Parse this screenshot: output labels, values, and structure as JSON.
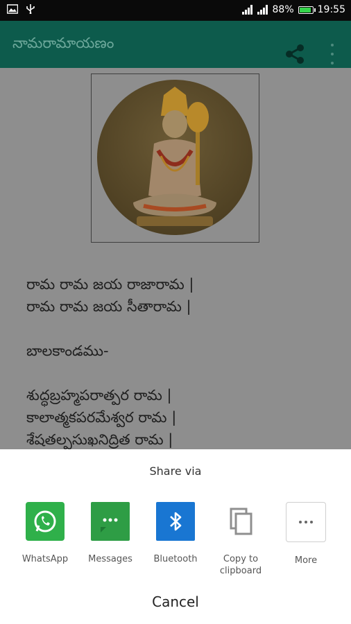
{
  "status_bar": {
    "battery_percent": "88%",
    "time": "19:55"
  },
  "app_bar": {
    "title": "నామరామాయణం",
    "share_icon": "share-icon",
    "more_icon": "more-vert-icon"
  },
  "content": {
    "verses": [
      "రామ రామ జయ రాజారామ |",
      "రామ రామ జయ సీతారామ |",
      "",
      "బాలకాండము-",
      "",
      "శుద్ధబ్రహ్మపరాత్పర రామ |",
      "కాలాత్మకపరమేశ్వర రామ |",
      "శేషతల్పసుఖనిద్రిత రామ |"
    ]
  },
  "share_sheet": {
    "title": "Share via",
    "apps": [
      {
        "label": "WhatsApp",
        "icon": "whatsapp-icon",
        "color": "#2fb04a"
      },
      {
        "label": "Messages",
        "icon": "messages-icon",
        "color": "#2e9d45"
      },
      {
        "label": "Bluetooth",
        "icon": "bluetooth-icon",
        "color": "#1976d2"
      },
      {
        "label": "Copy to clipboard",
        "icon": "copy-icon",
        "color": "#9e9e9e"
      },
      {
        "label": "More",
        "icon": "more-icon",
        "color": "#ffffff"
      }
    ],
    "cancel": "Cancel"
  }
}
